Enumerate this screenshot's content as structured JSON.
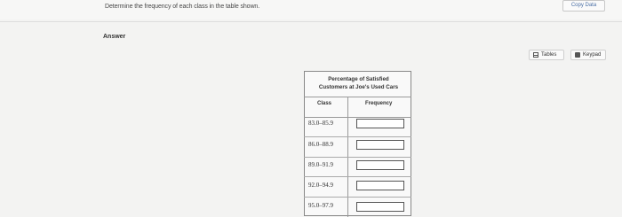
{
  "question": {
    "text": "Determine the frequency of each class in the table shown."
  },
  "toolbar": {
    "copy_data": "Copy Data",
    "tables": "Tables",
    "keypad": "Keypad"
  },
  "answer": {
    "label": "Answer"
  },
  "table": {
    "title_line1": "Percentage of Satisfied",
    "title_line2": "Customers at Joe's Used Cars",
    "col_class": "Class",
    "col_frequency": "Frequency",
    "rows": [
      {
        "class": "83.0–85.9",
        "frequency": ""
      },
      {
        "class": "86.0–88.9",
        "frequency": ""
      },
      {
        "class": "89.0–91.9",
        "frequency": ""
      },
      {
        "class": "92.0–94.9",
        "frequency": ""
      },
      {
        "class": "95.0–97.9",
        "frequency": ""
      }
    ]
  }
}
